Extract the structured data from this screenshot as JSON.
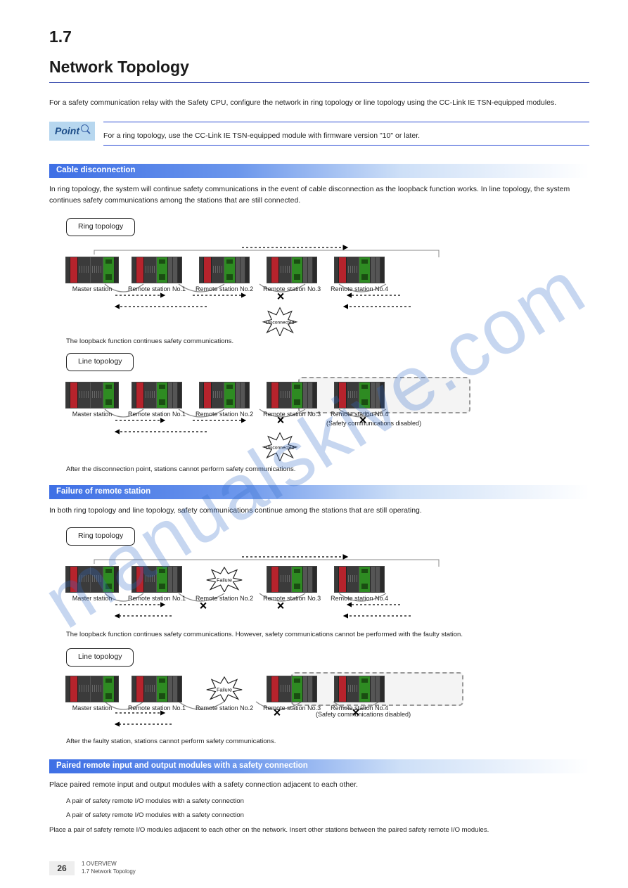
{
  "section_number": "1.7",
  "section_title": "Network Topology",
  "intro": "For a safety communication relay with the Safety CPU, configure the network in ring topology or line topology using the CC-Link IE TSN-equipped modules.",
  "point_label": "Point",
  "point_text": "For a ring topology, use the CC-Link IE TSN-equipped module with firmware version \"10\" or later.",
  "bar1": "Cable disconnection",
  "desc1": "In ring topology, the system will continue safety communications in the event of cable disconnection as the loopback function works. In line topology, the system continues safety communications among the stations that are still connected.",
  "label_ring": "Ring topology",
  "label_line": "Line topology",
  "ring1": {
    "role0": "Master station",
    "roles": [
      "Remote station No.1",
      "Remote station No.2",
      "Remote station No.3",
      "Remote station No.4"
    ],
    "burst": "Disconnected",
    "caption": "The loopback function continues safety communications."
  },
  "line1": {
    "role0": "Master station",
    "roles": [
      "Remote station No.1",
      "Remote station No.2",
      "Remote station No.3",
      "Remote station No.4"
    ],
    "burst": "Disconnected",
    "caption": "After the disconnection point, stations cannot perform safety communications.",
    "fade_note": "(Safety communications disabled)"
  },
  "bar2": "Failure of remote station",
  "desc2": "In both ring topology and line topology, safety communications continue among the stations that are still operating.",
  "ring2": {
    "role0": "Master station",
    "roles": [
      "Remote station No.1",
      "Remote station No.2",
      "Remote station No.3",
      "Remote station No.4"
    ],
    "burst": "Failure",
    "caption": "The loopback function continues safety communications. However, safety communications cannot be performed with the faulty station."
  },
  "line2": {
    "role0": "Master station",
    "roles": [
      "Remote station No.1",
      "Remote station No.2",
      "Remote station No.3",
      "Remote station No.4"
    ],
    "burst": "Failure",
    "caption": "After the faulty station, stations cannot perform safety communications.",
    "fade_note": "(Safety communications disabled)"
  },
  "bar3": "Paired remote input and output modules with a safety connection",
  "pair_desc": "Place paired remote input and output modules with a safety connection adjacent to each other.",
  "pair_notes": [
    "A pair of safety remote I/O modules with a safety connection",
    "A pair of safety remote I/O modules with a safety connection"
  ],
  "pair_caption": "Place a pair of safety remote I/O modules adjacent to each other on the network. Insert other stations between the paired safety remote I/O modules.",
  "footer": {
    "page": "26",
    "l1": "1 OVERVIEW",
    "l2": "1.7 Network Topology"
  }
}
